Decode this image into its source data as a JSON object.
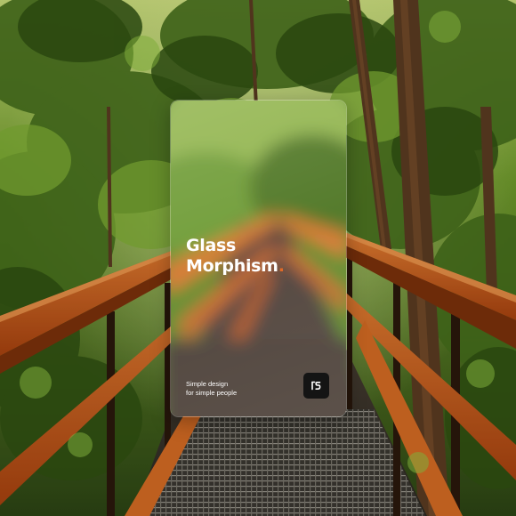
{
  "card": {
    "title_line1": "Glass",
    "title_line2": "Morphism",
    "title_dot": ".",
    "tagline_line1": "Simple design",
    "tagline_line2": "for simple people",
    "logo_icon": "ps-logo-icon"
  },
  "colors": {
    "accent": "#e06a28",
    "logo_bg": "#141414",
    "text": "#ffffff"
  }
}
